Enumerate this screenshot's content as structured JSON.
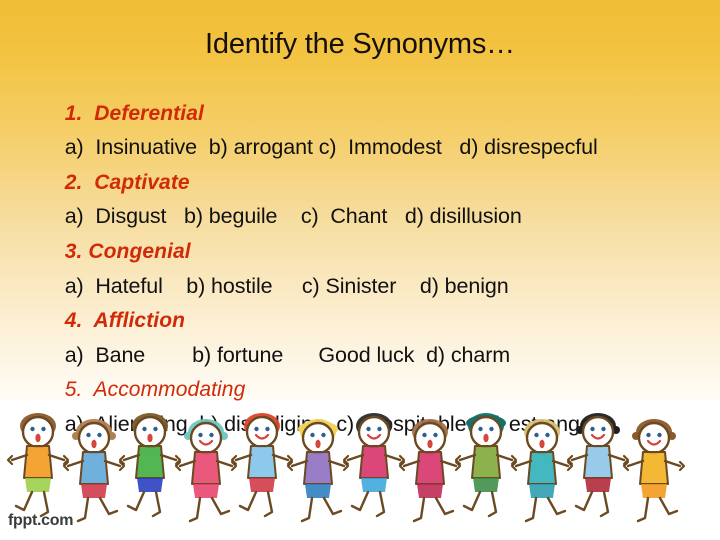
{
  "slide": {
    "title": "Identify the Synonyms…",
    "background": {
      "gradient_top": "#f1bd34",
      "gradient_bottom": "#fffefb",
      "lower_panel": "#ffffff"
    },
    "accent_color": "#d02a08",
    "text_color": "#120f0f"
  },
  "questions": [
    {
      "word_label": "1.  Deferential",
      "emphasis": "bold-italic",
      "options_line": "a)  Insinuative  b) arrogant c)  Immodest   d) disrespecful",
      "options": [
        {
          "key": "a)",
          "text": "Insinuative"
        },
        {
          "key": "b)",
          "text": "arrogant"
        },
        {
          "key": "c)",
          "text": "Immodest"
        },
        {
          "key": "d)",
          "text": "disrespecful"
        }
      ]
    },
    {
      "word_label": "2.  Captivate",
      "emphasis": "bold-italic",
      "options_line": "a)  Disgust   b) beguile    c)  Chant   d) disillusion",
      "options": [
        {
          "key": "a)",
          "text": "Disgust"
        },
        {
          "key": "b)",
          "text": "beguile"
        },
        {
          "key": "c)",
          "text": "Chant"
        },
        {
          "key": "d)",
          "text": "disillusion"
        }
      ]
    },
    {
      "word_label": "3. Congenial",
      "emphasis": "bold-italic",
      "options_line": "a)  Hateful    b) hostile     c) Sinister    d) benign",
      "options": [
        {
          "key": "a)",
          "text": "Hateful"
        },
        {
          "key": "b)",
          "text": "hostile"
        },
        {
          "key": "c)",
          "text": "Sinister"
        },
        {
          "key": "d)",
          "text": "benign"
        }
      ]
    },
    {
      "word_label": "4.  Affliction",
      "emphasis": "bold-italic",
      "options_line": "a)  Bane        b) fortune      Good luck  d) charm",
      "options": [
        {
          "key": "a)",
          "text": "Bane"
        },
        {
          "key": "b)",
          "text": "fortune"
        },
        {
          "key": "",
          "text": "Good luck"
        },
        {
          "key": "d)",
          "text": "charm"
        }
      ]
    },
    {
      "word_label": "5.  Accommodating",
      "emphasis": "italic",
      "options_line": "a)  Alienating  b) disobliging  c)  Hospitable   d) estranged",
      "options": [
        {
          "key": "a)",
          "text": "Alienating"
        },
        {
          "key": "b)",
          "text": "disobliging"
        },
        {
          "key": "c)",
          "text": "Hospitable"
        },
        {
          "key": "d)",
          "text": "estranged"
        }
      ]
    }
  ],
  "footer": {
    "watermark": "fppt.com"
  },
  "illustration": {
    "name": "children-holding-hands",
    "kids": [
      {
        "hair": "#8a5a2b",
        "shirt": "#f29a1e",
        "pants": "#9ccf4a",
        "mouth": "o",
        "hairstyle": "short"
      },
      {
        "hair": "#b08050",
        "shirt": "#5fa9d8",
        "pants": "#cf3b4c",
        "mouth": "o",
        "hairstyle": "pigtails"
      },
      {
        "hair": "#7a5a2a",
        "shirt": "#3fae3f",
        "pants": "#2a3fc0",
        "mouth": "o",
        "hairstyle": "short"
      },
      {
        "hair": "#6fc9c2",
        "shirt": "#e8466f",
        "pants": "#e8466f",
        "mouth": "smile",
        "hairstyle": "bow"
      },
      {
        "hair": "#e0452a",
        "shirt": "#7fc3e8",
        "pants": "#d23a4a",
        "mouth": "smile",
        "hairstyle": "short"
      },
      {
        "hair": "#f2d25a",
        "shirt": "#8e6fc0",
        "pants": "#2f7fc0",
        "mouth": "o",
        "hairstyle": "curly"
      },
      {
        "hair": "#2b2b2b",
        "shirt": "#d8336a",
        "pants": "#3fa9dc",
        "mouth": "smile",
        "hairstyle": "short"
      },
      {
        "hair": "#a5714a",
        "shirt": "#d8336a",
        "pants": "#c02a55",
        "mouth": "o",
        "hairstyle": "short"
      },
      {
        "hair": "#14706a",
        "shirt": "#7fa83a",
        "pants": "#3f8f4a",
        "mouth": "o",
        "hairstyle": "bob"
      },
      {
        "hair": "#d8c070",
        "shirt": "#2fb0b8",
        "pants": "#2f9fb0",
        "mouth": "o",
        "hairstyle": "short"
      },
      {
        "hair": "#1f1f1f",
        "shirt": "#8fc4e8",
        "pants": "#b02a3a",
        "mouth": "smile",
        "hairstyle": "bow"
      },
      {
        "hair": "#8a5a2b",
        "shirt": "#f2b01e",
        "pants": "#f29a1e",
        "mouth": "smile",
        "hairstyle": "pigtails"
      }
    ]
  }
}
